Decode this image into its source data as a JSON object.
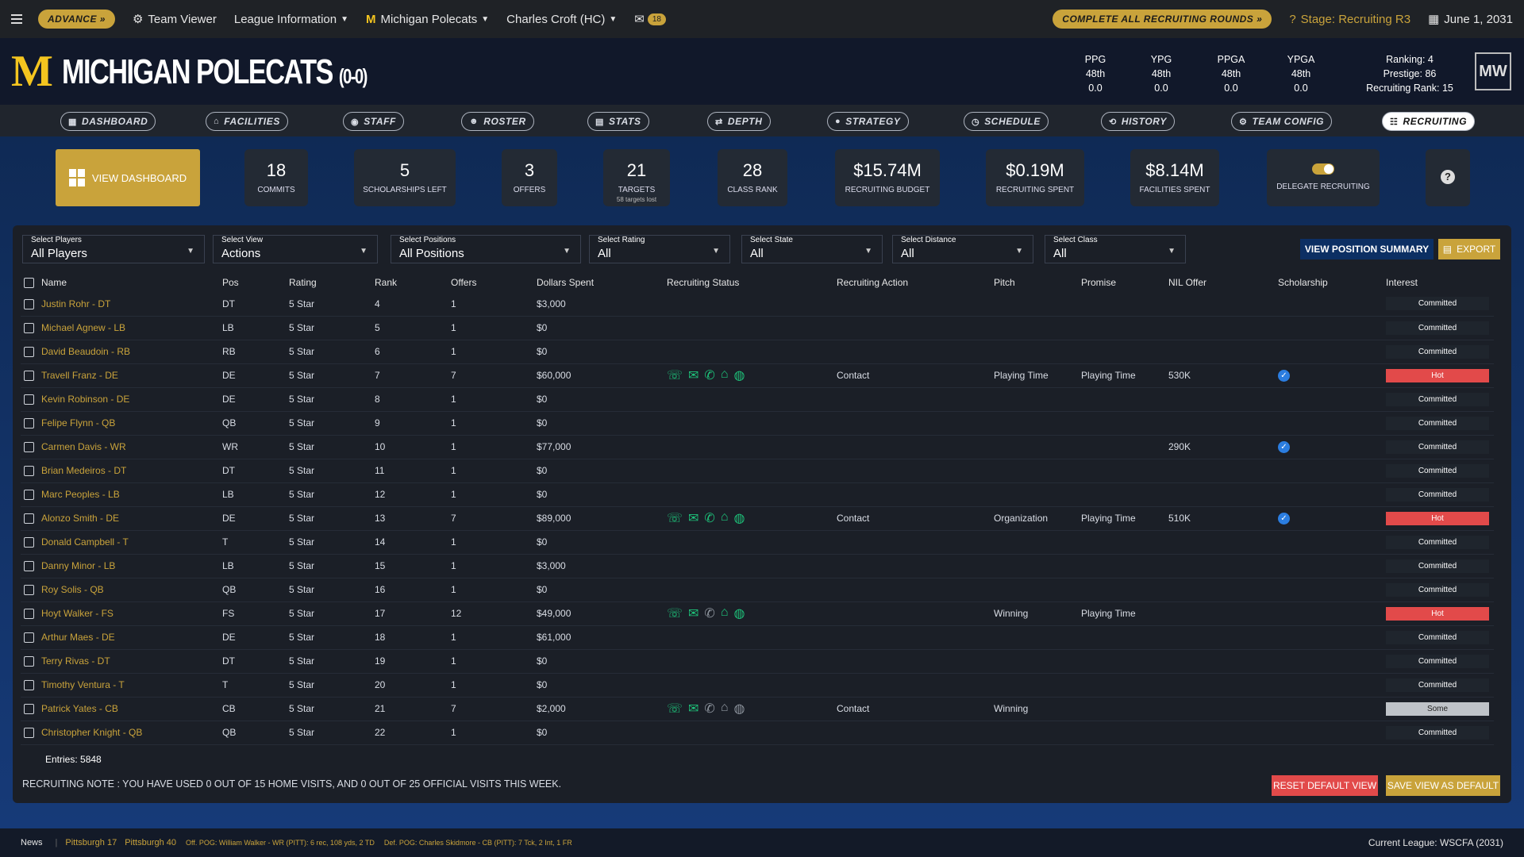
{
  "topbar": {
    "advance": "ADVANCE",
    "team_viewer": "Team Viewer",
    "league_info": "League Information",
    "team": "Michigan Polecats",
    "coach": "Charles Croft (HC)",
    "mail_count": "18",
    "complete_rounds": "COMPLETE ALL RECRUITING ROUNDS",
    "stage": "Stage: Recruiting R3",
    "date": "June 1, 2031"
  },
  "header": {
    "logo": "M",
    "team_name": "MICHIGAN POLECATS",
    "record": "(0-0)",
    "conf_logo": "MW",
    "stats": [
      {
        "label": "PPG",
        "rank": "48th",
        "value": "0.0"
      },
      {
        "label": "YPG",
        "rank": "48th",
        "value": "0.0"
      },
      {
        "label": "PPGA",
        "rank": "48th",
        "value": "0.0"
      },
      {
        "label": "YPGA",
        "rank": "48th",
        "value": "0.0"
      }
    ],
    "ranking": "Ranking: 4",
    "prestige": "Prestige: 86",
    "recruiting_rank": "Recruiting Rank: 15"
  },
  "nav": [
    "DASHBOARD",
    "FACILITIES",
    "STAFF",
    "ROSTER",
    "STATS",
    "DEPTH",
    "STRATEGY",
    "SCHEDULE",
    "HISTORY",
    "TEAM CONFIG",
    "RECRUITING"
  ],
  "cards": {
    "view_dashboard": "VIEW DASHBOARD",
    "commits": {
      "v": "18",
      "l": "COMMITS"
    },
    "scholarships": {
      "v": "5",
      "l": "SCHOLARSHIPS LEFT"
    },
    "offers": {
      "v": "3",
      "l": "OFFERS"
    },
    "targets": {
      "v": "21",
      "l": "TARGETS",
      "s": "58 targets lost"
    },
    "class_rank": {
      "v": "28",
      "l": "CLASS RANK"
    },
    "budget": {
      "v": "$15.74M",
      "l": "RECRUITING BUDGET"
    },
    "spent": {
      "v": "$0.19M",
      "l": "RECRUITING SPENT"
    },
    "facilities": {
      "v": "$8.14M",
      "l": "FACILITIES SPENT"
    },
    "delegate": "DELEGATE RECRUITING",
    "help": "?"
  },
  "filters": [
    {
      "label": "Select Players",
      "value": "All Players"
    },
    {
      "label": "Select View",
      "value": "Actions"
    },
    {
      "label": "Select Positions",
      "value": "All Positions"
    },
    {
      "label": "Select Rating",
      "value": "All"
    },
    {
      "label": "Select State",
      "value": "All"
    },
    {
      "label": "Select Distance",
      "value": "All"
    },
    {
      "label": "Select Class",
      "value": "All"
    }
  ],
  "buttons": {
    "view_position_summary": "VIEW POSITION SUMMARY",
    "export": "EXPORT",
    "reset": "RESET DEFAULT VIEW",
    "save": "SAVE VIEW AS DEFAULT"
  },
  "table": {
    "headers": [
      "Name",
      "Pos",
      "Rating",
      "Rank",
      "Offers",
      "Dollars Spent",
      "Recruiting Status",
      "Recruiting Action",
      "Pitch",
      "Promise",
      "NIL Offer",
      "Scholarship",
      "Interest"
    ],
    "rows": [
      {
        "name": "Justin Rohr - DT",
        "pos": "DT",
        "rating": "5 Star",
        "rank": "4",
        "offers": "1",
        "dollars": "$3,000",
        "status": "",
        "action": "",
        "pitch": "",
        "promise": "",
        "nil": "",
        "schol": false,
        "interest": "Committed"
      },
      {
        "name": "Michael Agnew - LB",
        "pos": "LB",
        "rating": "5 Star",
        "rank": "5",
        "offers": "1",
        "dollars": "$0",
        "status": "",
        "action": "",
        "pitch": "",
        "promise": "",
        "nil": "",
        "schol": false,
        "interest": "Committed"
      },
      {
        "name": "David Beaudoin - RB",
        "pos": "RB",
        "rating": "5 Star",
        "rank": "6",
        "offers": "1",
        "dollars": "$0",
        "status": "",
        "action": "",
        "pitch": "",
        "promise": "",
        "nil": "",
        "schol": false,
        "interest": "Committed"
      },
      {
        "name": "Travell Franz - DE",
        "pos": "DE",
        "rating": "5 Star",
        "rank": "7",
        "offers": "7",
        "dollars": "$60,000",
        "status": "full",
        "action": "Contact",
        "pitch": "Playing Time",
        "promise": "Playing Time",
        "nil": "530K",
        "schol": true,
        "interest": "Hot"
      },
      {
        "name": "Kevin Robinson - DE",
        "pos": "DE",
        "rating": "5 Star",
        "rank": "8",
        "offers": "1",
        "dollars": "$0",
        "status": "",
        "action": "",
        "pitch": "",
        "promise": "",
        "nil": "",
        "schol": false,
        "interest": "Committed"
      },
      {
        "name": "Felipe Flynn - QB",
        "pos": "QB",
        "rating": "5 Star",
        "rank": "9",
        "offers": "1",
        "dollars": "$0",
        "status": "",
        "action": "",
        "pitch": "",
        "promise": "",
        "nil": "",
        "schol": false,
        "interest": "Committed"
      },
      {
        "name": "Carmen Davis - WR",
        "pos": "WR",
        "rating": "5 Star",
        "rank": "10",
        "offers": "1",
        "dollars": "$77,000",
        "status": "",
        "action": "",
        "pitch": "",
        "promise": "",
        "nil": "290K",
        "schol": true,
        "interest": "Committed"
      },
      {
        "name": "Brian Medeiros - DT",
        "pos": "DT",
        "rating": "5 Star",
        "rank": "11",
        "offers": "1",
        "dollars": "$0",
        "status": "",
        "action": "",
        "pitch": "",
        "promise": "",
        "nil": "",
        "schol": false,
        "interest": "Committed"
      },
      {
        "name": "Marc Peoples - LB",
        "pos": "LB",
        "rating": "5 Star",
        "rank": "12",
        "offers": "1",
        "dollars": "$0",
        "status": "",
        "action": "",
        "pitch": "",
        "promise": "",
        "nil": "",
        "schol": false,
        "interest": "Committed"
      },
      {
        "name": "Alonzo Smith - DE",
        "pos": "DE",
        "rating": "5 Star",
        "rank": "13",
        "offers": "7",
        "dollars": "$89,000",
        "status": "full",
        "action": "Contact",
        "pitch": "Organization",
        "promise": "Playing Time",
        "nil": "510K",
        "schol": true,
        "interest": "Hot"
      },
      {
        "name": "Donald Campbell - T",
        "pos": "T",
        "rating": "5 Star",
        "rank": "14",
        "offers": "1",
        "dollars": "$0",
        "status": "",
        "action": "",
        "pitch": "",
        "promise": "",
        "nil": "",
        "schol": false,
        "interest": "Committed"
      },
      {
        "name": "Danny Minor - LB",
        "pos": "LB",
        "rating": "5 Star",
        "rank": "15",
        "offers": "1",
        "dollars": "$3,000",
        "status": "",
        "action": "",
        "pitch": "",
        "promise": "",
        "nil": "",
        "schol": false,
        "interest": "Committed"
      },
      {
        "name": "Roy Solis - QB",
        "pos": "QB",
        "rating": "5 Star",
        "rank": "16",
        "offers": "1",
        "dollars": "$0",
        "status": "",
        "action": "",
        "pitch": "",
        "promise": "",
        "nil": "",
        "schol": false,
        "interest": "Committed"
      },
      {
        "name": "Hoyt Walker - FS",
        "pos": "FS",
        "rating": "5 Star",
        "rank": "17",
        "offers": "12",
        "dollars": "$49,000",
        "status": "partial",
        "action": "",
        "pitch": "Winning",
        "promise": "Playing Time",
        "nil": "",
        "schol": false,
        "interest": "Hot"
      },
      {
        "name": "Arthur Maes - DE",
        "pos": "DE",
        "rating": "5 Star",
        "rank": "18",
        "offers": "1",
        "dollars": "$61,000",
        "status": "",
        "action": "",
        "pitch": "",
        "promise": "",
        "nil": "",
        "schol": false,
        "interest": "Committed"
      },
      {
        "name": "Terry Rivas - DT",
        "pos": "DT",
        "rating": "5 Star",
        "rank": "19",
        "offers": "1",
        "dollars": "$0",
        "status": "",
        "action": "",
        "pitch": "",
        "promise": "",
        "nil": "",
        "schol": false,
        "interest": "Committed"
      },
      {
        "name": "Timothy Ventura - T",
        "pos": "T",
        "rating": "5 Star",
        "rank": "20",
        "offers": "1",
        "dollars": "$0",
        "status": "",
        "action": "",
        "pitch": "",
        "promise": "",
        "nil": "",
        "schol": false,
        "interest": "Committed"
      },
      {
        "name": "Patrick Yates - CB",
        "pos": "CB",
        "rating": "5 Star",
        "rank": "21",
        "offers": "7",
        "dollars": "$2,000",
        "status": "contact",
        "action": "Contact",
        "pitch": "Winning",
        "promise": "",
        "nil": "",
        "schol": false,
        "interest": "Some"
      },
      {
        "name": "Christopher Knight - QB",
        "pos": "QB",
        "rating": "5 Star",
        "rank": "22",
        "offers": "1",
        "dollars": "$0",
        "status": "",
        "action": "",
        "pitch": "",
        "promise": "",
        "nil": "",
        "schol": false,
        "interest": "Committed"
      }
    ]
  },
  "entries": "Entries: 5848",
  "note": "RECRUITING NOTE : YOU HAVE USED 0 OUT OF 15 HOME VISITS, AND 0 OUT OF 25 OFFICIAL VISITS THIS WEEK.",
  "footer": {
    "news": "News",
    "score1": "Pittsburgh 17",
    "score2": "Pittsburgh 40",
    "off_pog": "Off. POG: William Walker - WR (PITT): 6 rec, 108 yds, 2 TD",
    "def_pog": "Def. POG: Charles Skidmore - CB (PITT): 7 Tck, 2 Int, 1 FR",
    "league": "Current League: WSCFA (2031)"
  },
  "colors": {
    "gold": "#c9a33b",
    "hot": "#e24a4a",
    "navy": "#0c2f63",
    "status_green": "#1ec27a"
  }
}
